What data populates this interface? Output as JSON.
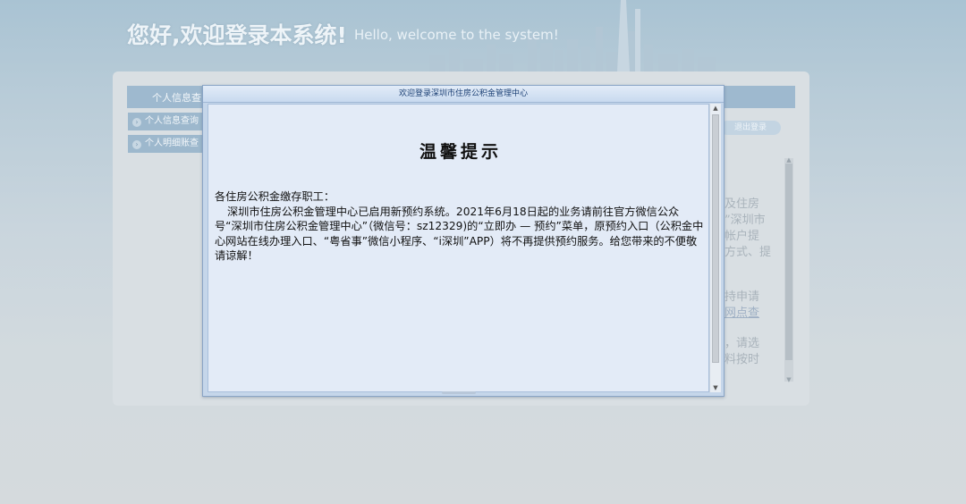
{
  "header": {
    "title_cn": "您好,欢迎登录本系统!",
    "title_en": "Hello, welcome to the system!"
  },
  "background": {
    "tab_label": "个人信息查",
    "left_items": [
      "个人信息查询",
      "个人明细账查"
    ],
    "logout_label": "退出登录",
    "right_snippets": [
      "及住房",
      "”深圳市",
      "帐户提",
      "方式、提",
      "持申请",
      "网点查",
      "，请选",
      "料按时"
    ]
  },
  "dialog": {
    "title": "欢迎登录深圳市住房公积金管理中心",
    "notice_title": "温馨提示",
    "greeting": "各住房公积金缴存职工：",
    "body": "深圳市住房公积金管理中心已启用新预约系统。2021年6月18日起的业务请前往官方微信公众号“深圳市住房公积金管理中心”（微信号：sz12329)的“立即办 — 预约”菜单，原预约入口（公积金中心网站在线办理入口、“粤省事”微信小程序、“i深圳”APP）将不再提供预约服务。给您带来的不便敬请谅解！"
  },
  "colors": {
    "dialog_title_text": "#1b3f74",
    "dialog_body_bg": "#e3ebf7",
    "page_bg": "#c9d5dd"
  }
}
